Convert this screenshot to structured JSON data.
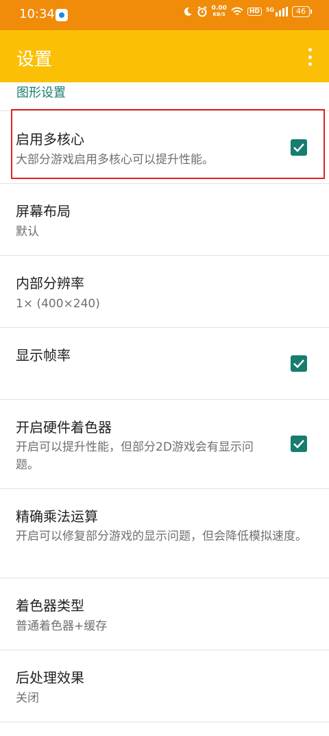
{
  "status_bar": {
    "time": "10:34",
    "net_speed_value": "0.00",
    "net_speed_unit": "KB/S",
    "hd_label": "HD",
    "signal_label": "5G",
    "battery": "46",
    "icons": [
      "app-notification-icon",
      "moon-icon",
      "alarm-icon",
      "wifi-icon",
      "signal-icon",
      "battery-icon"
    ]
  },
  "app_bar": {
    "title": "设置",
    "menu_icon": "more-vert-icon"
  },
  "section_header": "图形设置",
  "items": [
    {
      "title": "启用多核心",
      "summary": "大部分游戏启用多核心可以提升性能。",
      "checked": true
    },
    {
      "title": "屏幕布局",
      "summary": "默认"
    },
    {
      "title": "内部分辨率",
      "summary": "1× (400×240)"
    },
    {
      "title": "显示帧率",
      "summary": "",
      "checked": true
    },
    {
      "title": "开启硬件着色器",
      "summary": "开启可以提升性能，但部分2D游戏会有显示问题。",
      "checked": true
    },
    {
      "title": "精确乘法运算",
      "summary": "开启可以修复部分游戏的显示问题，但会降低模拟速度。"
    },
    {
      "title": "着色器类型",
      "summary": "普通着色器+缓存"
    },
    {
      "title": "后处理效果",
      "summary": "关闭"
    }
  ],
  "colors": {
    "status_bar": "#f08c0a",
    "app_bar": "#fbc005",
    "accent": "#167d6f",
    "highlight": "#e0201f"
  }
}
